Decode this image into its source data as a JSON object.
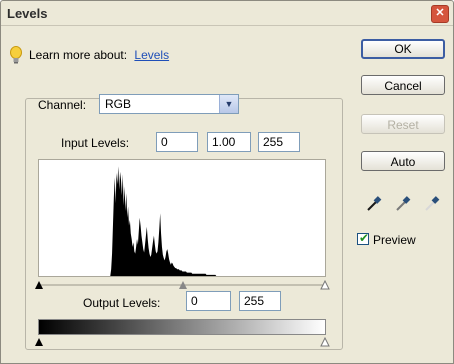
{
  "window": {
    "title": "Levels",
    "close_symbol": "✕"
  },
  "learn": {
    "prefix": "Learn more about:",
    "link": "Levels"
  },
  "buttons": {
    "ok": "OK",
    "cancel": "Cancel",
    "reset": "Reset",
    "auto": "Auto"
  },
  "channel": {
    "label": "Channel:",
    "value": "RGB"
  },
  "input_levels": {
    "label": "Input Levels:",
    "black": "0",
    "gamma": "1.00",
    "white": "255"
  },
  "output_levels": {
    "label": "Output Levels:",
    "black": "0",
    "white": "255"
  },
  "preview": {
    "label": "Preview",
    "checked": true
  },
  "icons": [
    "lightbulb-icon",
    "chevron-down-icon",
    "black-eyedropper-icon",
    "gray-eyedropper-icon",
    "white-eyedropper-icon",
    "close-icon"
  ],
  "histogram": {
    "levels": [
      0,
      0,
      0,
      0,
      0,
      0,
      0,
      0,
      0,
      0,
      0,
      0,
      0,
      0,
      0,
      0,
      0,
      0,
      0,
      0,
      0,
      0,
      0,
      0,
      0,
      0,
      0,
      0,
      0,
      0,
      0,
      0,
      0,
      0,
      0,
      0,
      0,
      0,
      0,
      0,
      0,
      0,
      0,
      0,
      0,
      0,
      0,
      0,
      0,
      0,
      0,
      0,
      0,
      0,
      0,
      0,
      0,
      0,
      0,
      0,
      0,
      0,
      0,
      0,
      0,
      0,
      0,
      0,
      0,
      0,
      0,
      0,
      0,
      0,
      0,
      0,
      0,
      0,
      0,
      0,
      0,
      0.06,
      0.2,
      0.45,
      0.7,
      0.88,
      0.65,
      0.92,
      0.82,
      0.98,
      0.77,
      0.93,
      0.86,
      0.72,
      0.91,
      0.63,
      0.8,
      0.58,
      0.74,
      0.52,
      0.62,
      0.45,
      0.5,
      0.38,
      0.33,
      0.26,
      0.3,
      0.22,
      0.2,
      0.26,
      0.33,
      0.28,
      0.4,
      0.52,
      0.45,
      0.36,
      0.3,
      0.24,
      0.21,
      0.28,
      0.36,
      0.44,
      0.33,
      0.25,
      0.2,
      0.17,
      0.19,
      0.25,
      0.31,
      0.36,
      0.28,
      0.22,
      0.2,
      0.22,
      0.3,
      0.42,
      0.56,
      0.38,
      0.26,
      0.19,
      0.16,
      0.14,
      0.17,
      0.22,
      0.24,
      0.2,
      0.15,
      0.12,
      0.1,
      0.12,
      0.11,
      0.09,
      0.08,
      0.07,
      0.07,
      0.06,
      0.06,
      0.06,
      0.05,
      0.05,
      0.05,
      0.04,
      0.04,
      0.04,
      0.04,
      0.04,
      0.03,
      0.03,
      0.03,
      0.03,
      0.03,
      0.03,
      0.02,
      0.02,
      0.02,
      0.02,
      0.02,
      0.02,
      0.02,
      0.02,
      0.02,
      0.02,
      0.02,
      0.02,
      0.02,
      0.02,
      0.02,
      0.02,
      0.01,
      0.01,
      0.01,
      0.01,
      0.01,
      0.01,
      0.01,
      0.01,
      0.01,
      0.01,
      0.01,
      0,
      0,
      0,
      0,
      0,
      0,
      0,
      0,
      0,
      0,
      0,
      0,
      0,
      0,
      0,
      0,
      0,
      0,
      0,
      0,
      0,
      0,
      0,
      0,
      0,
      0,
      0,
      0,
      0,
      0,
      0,
      0,
      0,
      0,
      0,
      0,
      0,
      0,
      0,
      0,
      0,
      0,
      0,
      0,
      0,
      0,
      0,
      0,
      0,
      0,
      0,
      0,
      0,
      0,
      0,
      0,
      0,
      0,
      0,
      0,
      0,
      0,
      0,
      0,
      0,
      0,
      0,
      0,
      0,
      0,
      0,
      0,
      0,
      0,
      0,
      0,
      0,
      0,
      0,
      0,
      0,
      0,
      0,
      0,
      0,
      0,
      0,
      0,
      0,
      0,
      0,
      0,
      0,
      0,
      0,
      0,
      0,
      0,
      0,
      0,
      0,
      0,
      0,
      0,
      0,
      0,
      0,
      0,
      0,
      0,
      0,
      0,
      0,
      0,
      0,
      0,
      0,
      0,
      0,
      0,
      0,
      0,
      0
    ]
  }
}
